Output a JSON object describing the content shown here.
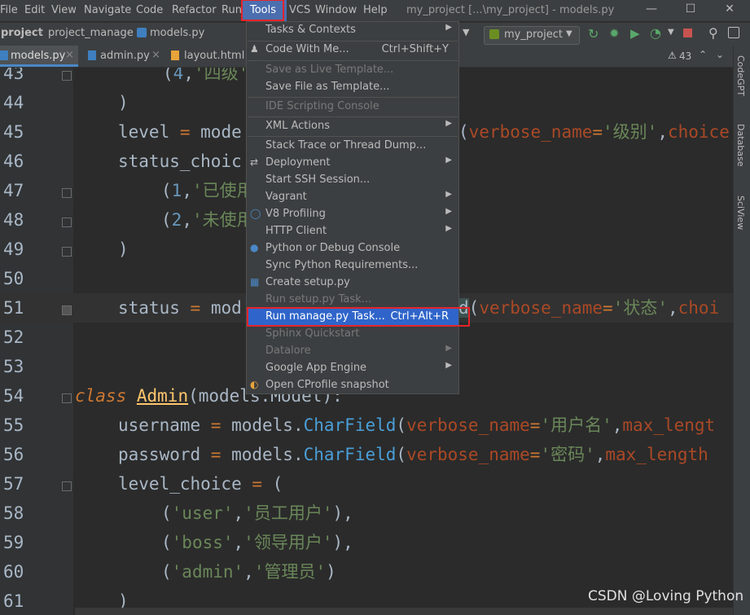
{
  "menu": {
    "items": [
      "File",
      "Edit",
      "View",
      "Navigate",
      "Code",
      "Refactor",
      "Run",
      "Tools",
      "VCS",
      "Window",
      "Help"
    ],
    "file": "File",
    "edit": "Edit",
    "view": "View",
    "navigate": "Navigate",
    "code": "Code",
    "refactor": "Refactor",
    "run": "Run",
    "tools": "Tools",
    "vcs": "VCS",
    "window": "Window",
    "help": "Help"
  },
  "window": {
    "title": "my_project [...\\my_project] - models.py"
  },
  "breadcrumb": {
    "project": "project",
    "folder": "project_manage",
    "file": "models.py"
  },
  "run_config": {
    "label": "my_project"
  },
  "tabs": {
    "t1": "models.py",
    "t2": "admin.py",
    "t3": "layout.html"
  },
  "inspection": {
    "count": "43"
  },
  "side": {
    "codegpt": "CodeGPT",
    "database": "Database",
    "sciview": "SciView"
  },
  "tools_menu": {
    "tasks": "Tasks & Contexts",
    "code_with_me": "Code With Me...",
    "code_with_me_sc": "Ctrl+Shift+Y",
    "save_live": "Save as Live Template...",
    "save_file": "Save File as Template...",
    "ide_console": "IDE Scripting Console",
    "xml": "XML Actions",
    "stack": "Stack Trace or Thread Dump...",
    "deployment": "Deployment",
    "ssh": "Start SSH Session...",
    "vagrant": "Vagrant",
    "v8": "V8 Profiling",
    "http": "HTTP Client",
    "python_console": "Python or Debug Console",
    "sync_req": "Sync Python Requirements...",
    "create_setup": "Create setup.py",
    "run_setup": "Run setup.py Task...",
    "run_manage": "Run manage.py Task...",
    "run_manage_sc": "Ctrl+Alt+R",
    "sphinx": "Sphinx Quickstart",
    "datalore": "Datalore",
    "gae": "Google App Engine",
    "cprofile": "Open CProfile snapshot"
  },
  "code": {
    "l43": "43",
    "l44": "44",
    "l45": "45",
    "l46": "46",
    "l47": "47",
    "l48": "48",
    "l49": "49",
    "l50": "50",
    "l51": "51",
    "l52": "52",
    "l53": "53",
    "l54": "54",
    "l55": "55",
    "l56": "56",
    "l57": "57",
    "l58": "58",
    "l59": "59",
    "l60": "60",
    "l61": "61"
  },
  "watermark": "CSDN @Loving Python",
  "colors": {
    "accent": "#4b6eaf",
    "highlight_box": "#e5242a",
    "selection": "#2f65ca"
  }
}
